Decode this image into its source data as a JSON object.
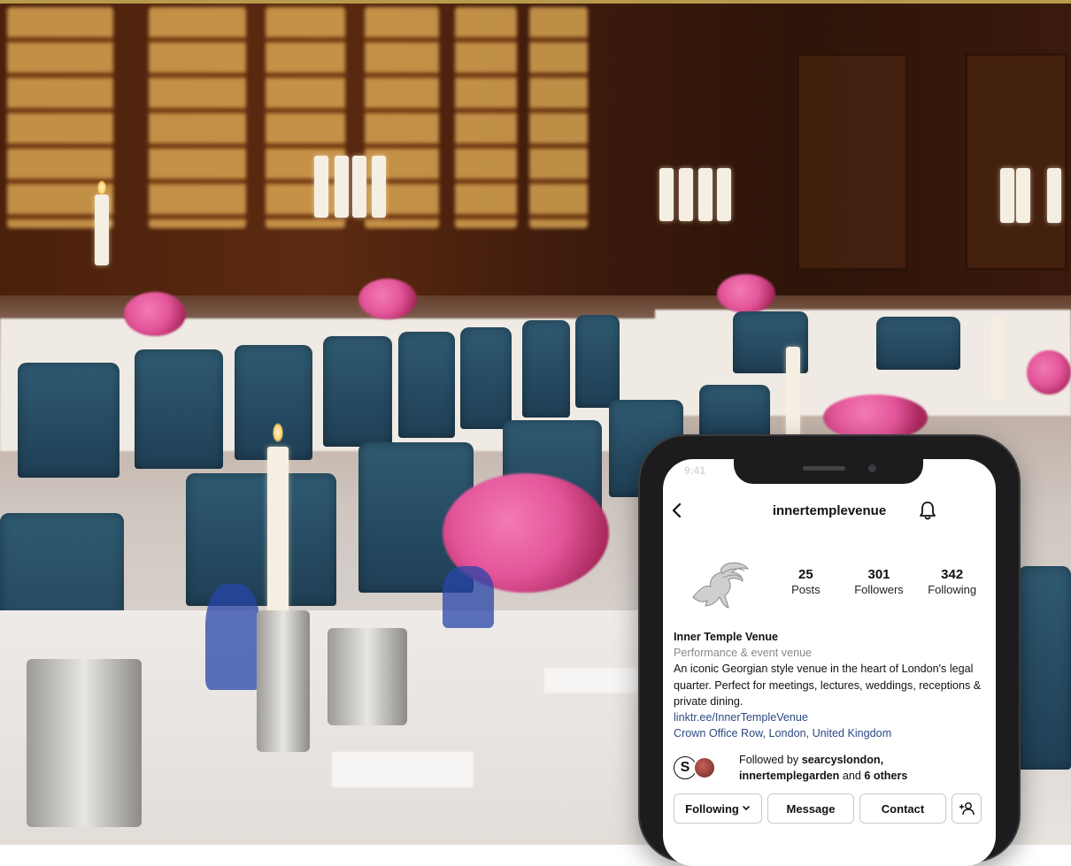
{
  "colors": {
    "link": "#2c4a82",
    "category_text": "#888888",
    "phone_frame": "#1c1c1e",
    "chair_blue": "#2f5a72",
    "wood": "#4a200c"
  },
  "profile": {
    "back_icon": "chevron-left-icon",
    "username": "innertemplevenue",
    "bell_icon": "bell-icon",
    "stats": [
      {
        "value": "25",
        "label": "Posts"
      },
      {
        "value": "301",
        "label": "Followers"
      },
      {
        "value": "342",
        "label": "Following"
      }
    ],
    "display_name": "Inner Temple Venue",
    "category": "Performance & event venue",
    "bio": "An iconic Georgian style venue in the heart of London's legal quarter. Perfect for meetings, lectures, weddings, receptions & private dining.",
    "link": "linktr.ee/InnerTempleVenue",
    "location": "Crown Office Row, London, United Kingdom",
    "followed_by": {
      "prefix": "Followed by",
      "user1": "searcyslondon,",
      "user2": "innertemplegarden",
      "middle": "and",
      "others": "6 others"
    },
    "buttons": {
      "following": "Following",
      "message": "Message",
      "contact": "Contact"
    },
    "add_user_icon": "add-person-icon"
  }
}
